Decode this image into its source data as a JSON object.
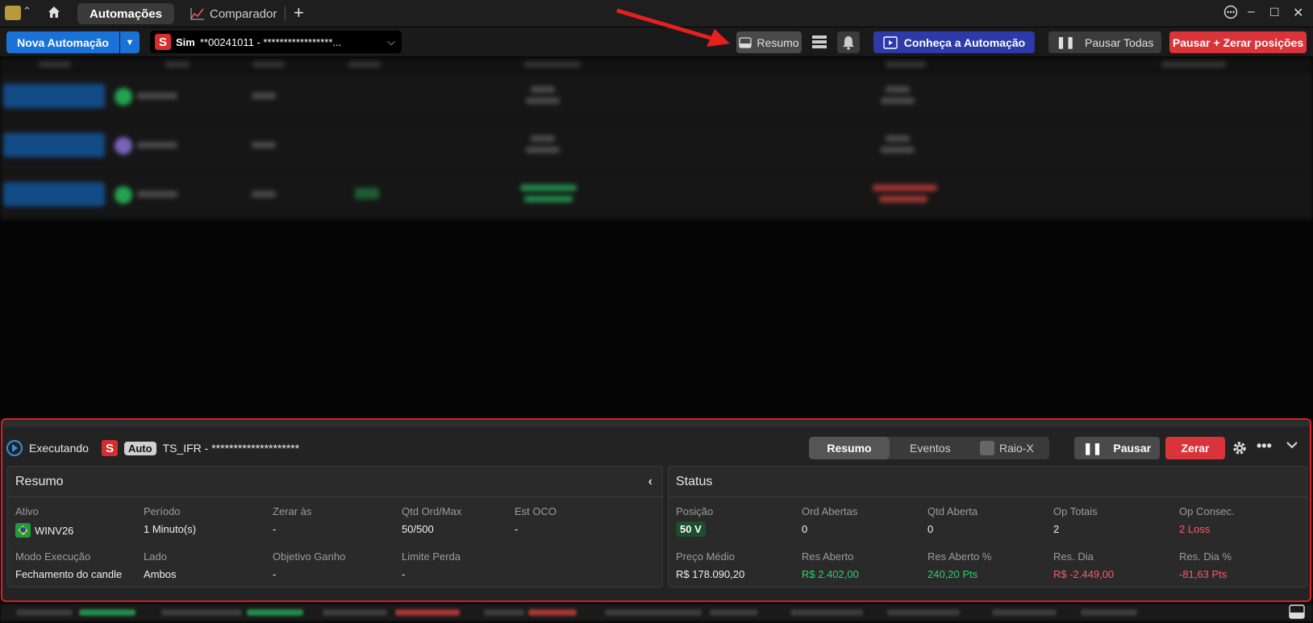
{
  "titlebar": {
    "tabs": [
      {
        "label": "Automações",
        "active": true
      },
      {
        "label": "Comparador",
        "active": false
      }
    ],
    "window_controls": [
      "more-icon",
      "minimize-icon",
      "maximize-icon",
      "close-icon"
    ]
  },
  "toolbar": {
    "new_automation": "Nova Automação",
    "account_badge": "S",
    "account_label": "Sim",
    "account_value": "**00241011 - *****************...",
    "resumo": "Resumo",
    "conheca": "Conheça a Automação",
    "pausar_todas": "Pausar Todas",
    "pausar_zerar": "Pausar + Zerar posições"
  },
  "panel": {
    "state": "Executando",
    "badge_s": "S",
    "badge_auto": "Auto",
    "strategy": "TS_IFR - ********************",
    "tabs": [
      "Resumo",
      "Eventos",
      "Raio-X"
    ],
    "pausar": "Pausar",
    "zerar": "Zerar",
    "resumo": {
      "title": "Resumo",
      "fields": [
        {
          "label": "Ativo",
          "value": "WINV26"
        },
        {
          "label": "Período",
          "value": "1 Minuto(s)"
        },
        {
          "label": "Zerar às",
          "value": "-"
        },
        {
          "label": "Qtd Ord/Max",
          "value": "50/500"
        },
        {
          "label": "Est OCO",
          "value": "-"
        },
        {
          "label": "Modo Execução",
          "value": "Fechamento do candle"
        },
        {
          "label": "Lado",
          "value": "Ambos"
        },
        {
          "label": "Objetivo Ganho",
          "value": "-"
        },
        {
          "label": "Limite Perda",
          "value": "-"
        }
      ]
    },
    "status": {
      "title": "Status",
      "fields": [
        {
          "label": "Posição",
          "value": "50 V"
        },
        {
          "label": "Ord Abertas",
          "value": "0"
        },
        {
          "label": "Qtd Aberta",
          "value": "0"
        },
        {
          "label": "Op Totais",
          "value": "2"
        },
        {
          "label": "Op Consec.",
          "value": "2 Loss"
        },
        {
          "label": "Preço Médio",
          "value": "R$ 178.090,20"
        },
        {
          "label": "Res Aberto",
          "value": "R$ 2.402,00"
        },
        {
          "label": "Res Aberto %",
          "value": "240,20 Pts"
        },
        {
          "label": "Res. Dia",
          "value": "R$ -2.449,00"
        },
        {
          "label": "Res. Dia %",
          "value": "-81,63 Pts"
        }
      ]
    }
  },
  "colors": {
    "accent_blue": "#1a72d6",
    "danger_red": "#d9343a",
    "purple": "#2e3aa8",
    "positive": "#2fd06a",
    "negative": "#ff5a5f"
  }
}
